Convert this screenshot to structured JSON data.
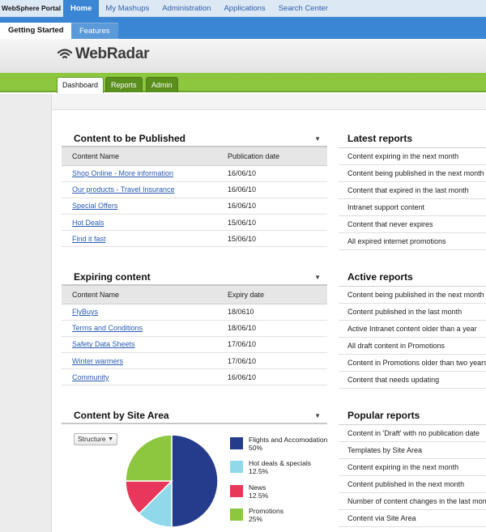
{
  "portal": {
    "brand": "WebSphere Portal",
    "nav": [
      "Home",
      "My Mashups",
      "Administration",
      "Applications",
      "Search Center"
    ]
  },
  "subtabs": {
    "active": "Getting Started",
    "other": "Features"
  },
  "app": {
    "logo": "WebRadar"
  },
  "tabs": [
    "Dashboard",
    "Reports",
    "Admin"
  ],
  "publish": {
    "title": "Content to be Published",
    "columns": [
      "Content Name",
      "Publication date"
    ],
    "rows": [
      [
        "Shop Online - More information",
        "16/06/10"
      ],
      [
        "Our products - Travel Insurance",
        "16/06/10"
      ],
      [
        "Special Offers",
        "16/06/10"
      ],
      [
        "Hot Deals",
        "15/06/10"
      ],
      [
        "Find it fast",
        "15/06/10"
      ]
    ]
  },
  "expiring": {
    "title": "Expiring content",
    "columns": [
      "Content Name",
      "Expiry date"
    ],
    "rows": [
      [
        "FlyBuys",
        "18/0610"
      ],
      [
        "Terms and Conditions",
        "18/06/10"
      ],
      [
        "Safety Data Sheets",
        "17/06/10"
      ],
      [
        "Winter warmers",
        "17/06/10"
      ],
      [
        "Community",
        "16/06/10"
      ]
    ]
  },
  "site_area": {
    "title": "Content by Site Area",
    "select_value": "Structure",
    "items": [
      {
        "name": "Flights and Accomodation",
        "pct": "50%",
        "value": 50,
        "color": "#253b8c"
      },
      {
        "name": "Hot deals & specials",
        "pct": "12.5%",
        "value": 12.5,
        "color": "#8fd9ea"
      },
      {
        "name": "News",
        "pct": "12.5%",
        "value": 12.5,
        "color": "#e8375a"
      },
      {
        "name": "Promotions",
        "pct": "25%",
        "value": 25,
        "color": "#8dc63f"
      }
    ]
  },
  "latest": {
    "title": "Latest reports",
    "items": [
      "Content expiring in the next month",
      "Content being published in the next month",
      "Content that expired in the last month",
      "Intranet support content",
      "Content that never expires",
      "All expired internet promotions"
    ]
  },
  "active": {
    "title": "Active reports",
    "items": [
      "Content being published in the next month",
      "Content published in the last month",
      "Active Intranet content older than a year",
      "All draft content in Promotions",
      "Content in Promotions older than two years",
      "Content that needs updating"
    ]
  },
  "popular": {
    "title": "Popular reports",
    "items": [
      "Content in 'Draft' with no publication date",
      "Templates by Site Area",
      "Content expiring in the next month",
      "Content published in the next month",
      "Number of content changes in the last month",
      "Content via Site Area"
    ]
  },
  "colors": {
    "portal_blue": "#3a86d4",
    "green": "#8dc63f",
    "link": "#2a5db0"
  }
}
